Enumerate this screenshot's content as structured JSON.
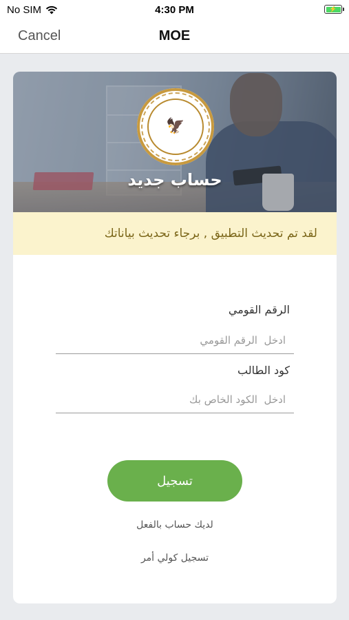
{
  "status_bar": {
    "carrier": "No SIM",
    "time": "4:30 PM"
  },
  "nav": {
    "cancel_label": "Cancel",
    "title": "MOE"
  },
  "banner": {
    "title": "حساب جديد",
    "emblem_text": "MINISTRY OF EDUCATION AND TECHNICAL EDUCATION"
  },
  "notice": {
    "text": "لقد تم تحديث التطبيق , برجاء تحديث بياناتك"
  },
  "form": {
    "national_id": {
      "label": "الرقم القومي",
      "placeholder": "ادخل  الرقم القومي"
    },
    "student_code": {
      "label": "كود الطالب",
      "placeholder": "ادخل  الكود الخاص بك"
    },
    "submit_label": "تسجيل",
    "have_account_link": "لديك حساب بالفعل",
    "guardian_register_link": "تسجيل كولي أمر"
  },
  "colors": {
    "accent_green": "#6ab04c",
    "notice_bg": "#fbf3cd",
    "notice_text": "#7a6518",
    "emblem_gold": "#c89a3f"
  },
  "icons": {
    "wifi": "wifi-icon",
    "battery": "battery-charging-icon",
    "emblem": "ministry-emblem-icon"
  }
}
